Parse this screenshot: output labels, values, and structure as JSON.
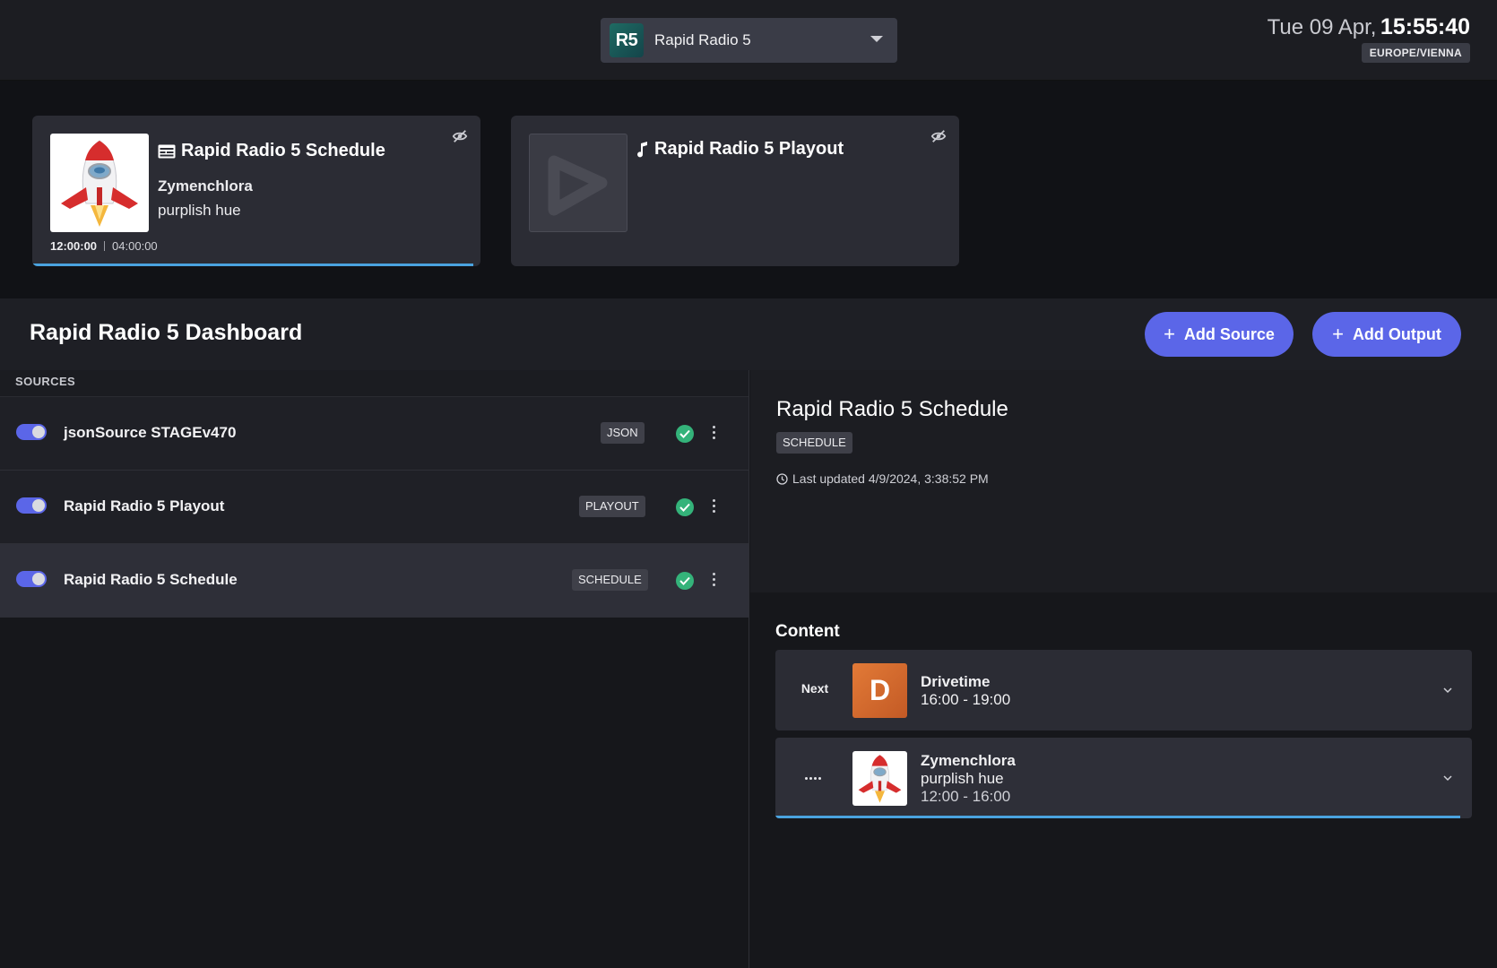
{
  "header": {
    "station": {
      "logo_text": "R5",
      "name": "Rapid Radio 5"
    },
    "clock": {
      "date": "Tue 09 Apr,",
      "time": "15:55:40",
      "timezone": "EUROPE/VIENNA"
    }
  },
  "now_playing": [
    {
      "icon": "schedule-icon",
      "title": "Rapid Radio 5 Schedule",
      "line1": "Zymenchlora",
      "line2": "purplish hue",
      "elapsed": "12:00:00",
      "duration": "04:00:00",
      "progress": 1.0
    },
    {
      "icon": "music-note-icon",
      "title": "Rapid Radio 5 Playout"
    }
  ],
  "dashboard": {
    "title": "Rapid Radio 5 Dashboard",
    "add_source_label": "Add Source",
    "add_output_label": "Add Output"
  },
  "sources": {
    "label": "SOURCES",
    "items": [
      {
        "name": "jsonSource STAGEv470",
        "type": "JSON",
        "enabled": true,
        "status": "ok"
      },
      {
        "name": "Rapid Radio 5 Playout",
        "type": "PLAYOUT",
        "enabled": true,
        "status": "ok"
      },
      {
        "name": "Rapid Radio 5 Schedule",
        "type": "SCHEDULE",
        "enabled": true,
        "status": "ok"
      }
    ]
  },
  "details": {
    "title": "Rapid Radio 5 Schedule",
    "type": "SCHEDULE",
    "last_updated": "Last updated 4/9/2024, 3:38:52 PM"
  },
  "content": {
    "title": "Content",
    "items": [
      {
        "label": "Next",
        "art_letter": "D",
        "title": "Drivetime",
        "time": "16:00 - 19:00"
      },
      {
        "label": "",
        "title": "Zymenchlora",
        "subtitle": "purplish hue",
        "time": "12:00 - 16:00",
        "progress": 1.0
      }
    ]
  },
  "colors": {
    "accent": "#5b66e8",
    "progress": "#4aa3df",
    "ok": "#34b37a",
    "drivetime_tile": "#d8692f"
  }
}
